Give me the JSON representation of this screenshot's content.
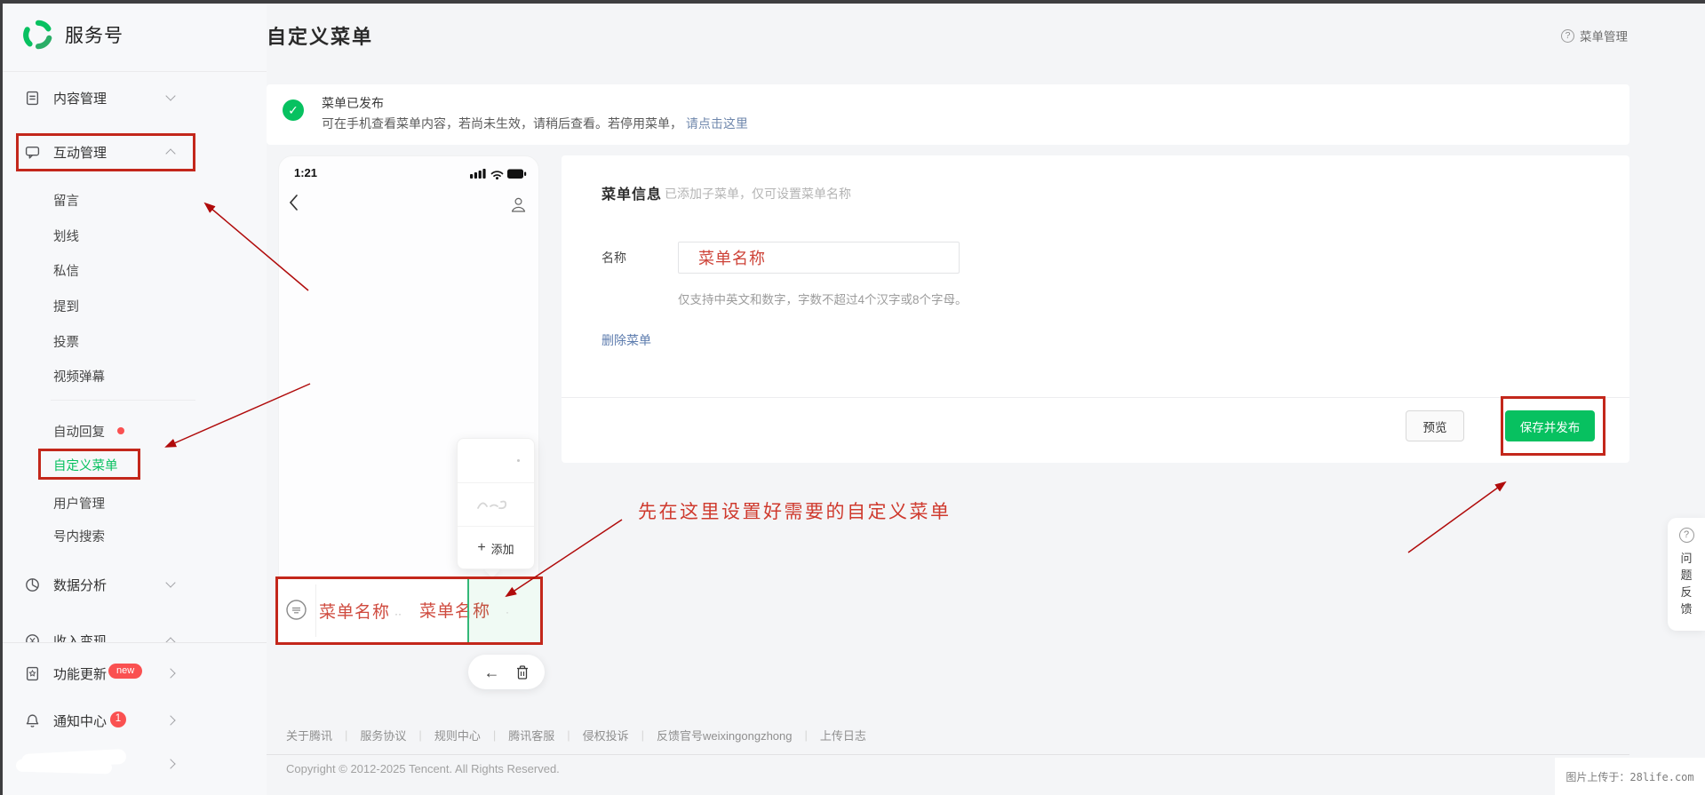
{
  "colors": {
    "brand_green": "#07C160",
    "annotation_red": "#C3271B",
    "badge_red": "#FA5151",
    "link_blue": "#7088AD"
  },
  "sidebar": {
    "brand": "服务号",
    "groups": {
      "content": {
        "label": "内容管理"
      },
      "interact": {
        "label": "互动管理"
      },
      "analytics": {
        "label": "数据分析"
      },
      "monetize": {
        "label": "收入变现"
      }
    },
    "interact_items": [
      {
        "label": "留言"
      },
      {
        "label": "划线"
      },
      {
        "label": "私信"
      },
      {
        "label": "提到"
      },
      {
        "label": "投票"
      },
      {
        "label": "视频弹幕"
      },
      {
        "label": "自动回复",
        "has_red_dot": true
      },
      {
        "label": "自定义菜单",
        "active": true
      },
      {
        "label": "用户管理"
      },
      {
        "label": "号内搜索"
      }
    ],
    "bottom": {
      "feature_update": {
        "label": "功能更新",
        "badge": "new"
      },
      "notification_center": {
        "label": "通知中心",
        "badge": "1"
      }
    }
  },
  "header": {
    "page_title": "自定义菜单",
    "help_icon": "?",
    "help_label": "菜单管理"
  },
  "banner": {
    "title": "菜单已发布",
    "body": "可在手机查看菜单内容，若尚未生效，请稍后查看。若停用菜单，",
    "link": "请点击这里"
  },
  "preview": {
    "status_time": "1:21",
    "popup": {
      "add_icon": "+",
      "add_label": "添加"
    },
    "menubar": {
      "item1": "菜单名称",
      "item2": "菜单名称",
      "dots": "··",
      "dot": "·"
    },
    "back_icon": "←"
  },
  "form": {
    "section_title": "菜单信息",
    "section_hint": "已添加子菜单，仅可设置菜单名称",
    "name_label": "名称",
    "name_value": "菜单名称",
    "rule_hint": "仅支持中英文和数字，字数不超过4个汉字或8个字母。",
    "delete_link": "删除菜单",
    "preview_button": "预览",
    "save_button": "保存并发布"
  },
  "annotation": {
    "tip": "先在这里设置好需要的自定义菜单"
  },
  "feedback": {
    "icon": "?",
    "label": "问题反馈"
  },
  "footer": {
    "links": [
      {
        "label": "关于腾讯"
      },
      {
        "label": "服务协议"
      },
      {
        "label": "规则中心"
      },
      {
        "label": "腾讯客服"
      },
      {
        "label": "侵权投诉"
      },
      {
        "label": "反馈官号weixingongzhong"
      },
      {
        "label": "上传日志"
      }
    ],
    "separator": "|",
    "copyright": "Copyright © 2012-2025 Tencent. All Rights Reserved."
  },
  "watermark": "图片上传于：28life.com"
}
